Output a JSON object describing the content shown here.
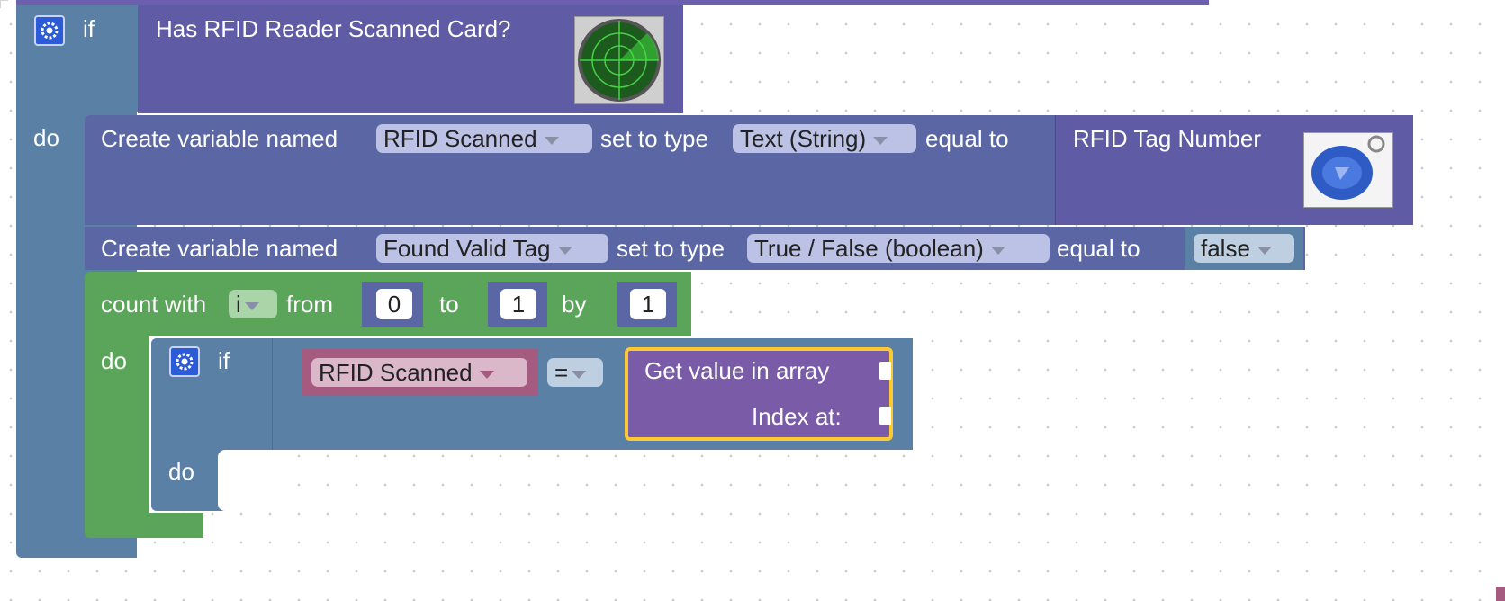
{
  "if_block": {
    "if_label": "if",
    "condition": "Has RFID Reader Scanned Card?",
    "do_label": "do"
  },
  "var1": {
    "prefix": "Create variable named",
    "name": "RFID Scanned",
    "set_type_label": "set to type",
    "type": "Text (String)",
    "equal_label": "equal to",
    "value_block": "RFID Tag Number"
  },
  "var2": {
    "prefix": "Create variable named",
    "name": "Found Valid Tag",
    "set_type_label": "set to type",
    "type": "True / False (boolean)",
    "equal_label": "equal to",
    "value": "false"
  },
  "loop": {
    "count_label": "count with",
    "var": "i",
    "from_label": "from",
    "from_value": "0",
    "to_label": "to",
    "to_value": "1",
    "by_label": "by",
    "by_value": "1",
    "do_label": "do"
  },
  "inner_if": {
    "if_label": "if",
    "left_var": "RFID Scanned",
    "operator": "=",
    "get_label": "Get value in array",
    "index_label": "Index at:",
    "do_label": "do"
  },
  "colors": {
    "control": "#5b80a5",
    "statement": "#5b67a5",
    "sensor": "#5f5ba5",
    "loop": "#5ba55b",
    "var_reporter": "#a55b80",
    "selection": "#fcc934"
  }
}
